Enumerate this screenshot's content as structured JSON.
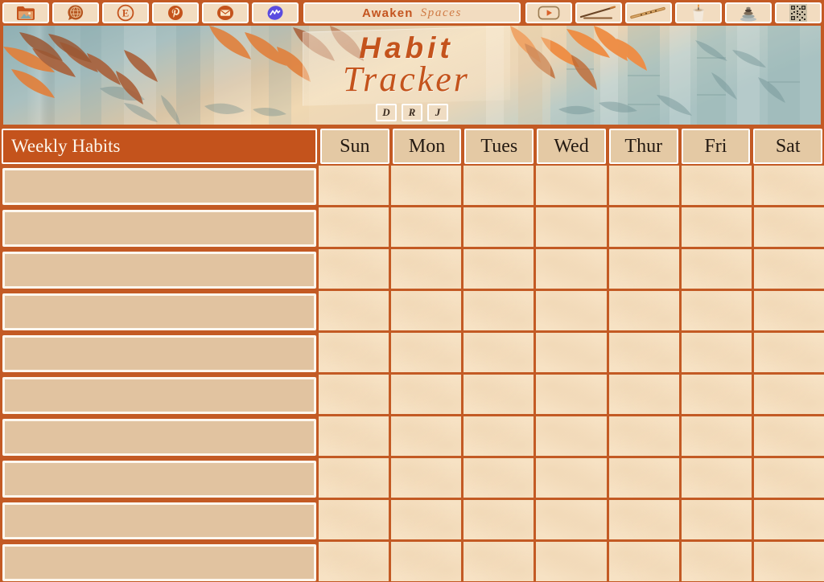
{
  "app": {
    "brand_primary": "Awaken",
    "brand_secondary": "Spaces",
    "accent_color": "#c35a24",
    "title_color": "#c4531c",
    "paper_color": "#f7e2c4",
    "habit_cell_color": "#e1c3a0"
  },
  "toolbar": {
    "items": [
      {
        "name": "folder-icon",
        "label": "Folder"
      },
      {
        "name": "globe-chat-icon",
        "label": "Globe Chat"
      },
      {
        "name": "etsy-icon",
        "label": "Etsy"
      },
      {
        "name": "pinterest-icon",
        "label": "Pinterest"
      },
      {
        "name": "email-icon",
        "label": "Email"
      },
      {
        "name": "wave-icon",
        "label": "Wave"
      }
    ],
    "right_items": [
      {
        "name": "youtube-icon",
        "label": "YouTube"
      },
      {
        "name": "incense-stick-icon",
        "label": "Incense Stick"
      },
      {
        "name": "flute-icon",
        "label": "Flute"
      },
      {
        "name": "candle-icon",
        "label": "Candle"
      },
      {
        "name": "zen-stones-icon",
        "label": "Zen Stones"
      },
      {
        "name": "qr-code-icon",
        "label": "QR Code"
      }
    ]
  },
  "banner": {
    "title_line1": "Habit",
    "title_line2": "Tracker",
    "initials": [
      "D",
      "R",
      "J"
    ]
  },
  "table": {
    "habits_header": "Weekly Habits",
    "days": [
      "Sun",
      "Mon",
      "Tues",
      "Wed",
      "Thur",
      "Fri",
      "Sat"
    ],
    "rows": [
      {
        "habit": ""
      },
      {
        "habit": ""
      },
      {
        "habit": ""
      },
      {
        "habit": ""
      },
      {
        "habit": ""
      },
      {
        "habit": ""
      },
      {
        "habit": ""
      },
      {
        "habit": ""
      },
      {
        "habit": ""
      },
      {
        "habit": ""
      }
    ]
  }
}
